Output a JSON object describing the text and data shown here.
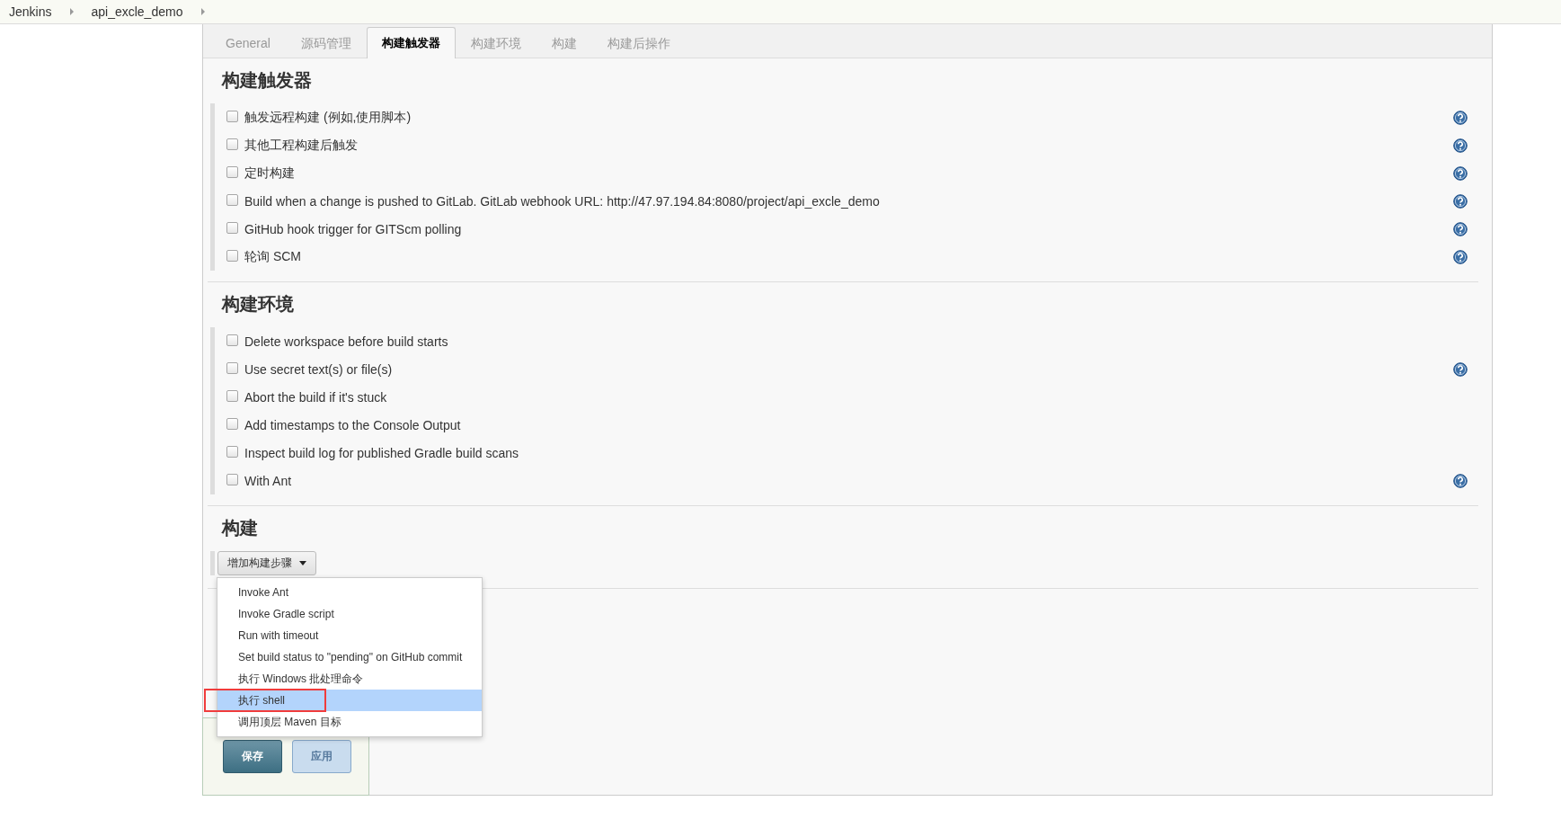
{
  "breadcrumbs": [
    {
      "label": "Jenkins"
    },
    {
      "label": "api_excle_demo"
    }
  ],
  "tabs": [
    {
      "label": "General",
      "selected": false
    },
    {
      "label": "源码管理",
      "selected": false
    },
    {
      "label": "构建触发器",
      "selected": true
    },
    {
      "label": "构建环境",
      "selected": false
    },
    {
      "label": "构建",
      "selected": false
    },
    {
      "label": "构建后操作",
      "selected": false
    }
  ],
  "sections": [
    {
      "title": "构建触发器",
      "options": [
        {
          "label": "触发远程构建 (例如,使用脚本)",
          "checked": false,
          "help": true
        },
        {
          "label": "其他工程构建后触发",
          "checked": false,
          "help": true
        },
        {
          "label": "定时构建",
          "checked": false,
          "help": true
        },
        {
          "label": "Build when a change is pushed to GitLab. GitLab webhook URL: http://47.97.194.84:8080/project/api_excle_demo",
          "checked": false,
          "help": true
        },
        {
          "label": "GitHub hook trigger for GITScm polling",
          "checked": false,
          "help": true
        },
        {
          "label": "轮询 SCM",
          "checked": false,
          "help": true
        }
      ]
    },
    {
      "title": "构建环境",
      "options": [
        {
          "label": "Delete workspace before build starts",
          "checked": false,
          "help": false
        },
        {
          "label": "Use secret text(s) or file(s)",
          "checked": false,
          "help": true
        },
        {
          "label": "Abort the build if it's stuck",
          "checked": false,
          "help": false
        },
        {
          "label": "Add timestamps to the Console Output",
          "checked": false,
          "help": false
        },
        {
          "label": "Inspect build log for published Gradle build scans",
          "checked": false,
          "help": false
        },
        {
          "label": "With Ant",
          "checked": false,
          "help": true
        }
      ]
    },
    {
      "title": "构建",
      "add_button": "增加构建步骤",
      "menu": [
        {
          "label": "Invoke Ant",
          "selected": false,
          "annotated": false
        },
        {
          "label": "Invoke Gradle script",
          "selected": false,
          "annotated": false
        },
        {
          "label": "Run with timeout",
          "selected": false,
          "annotated": false
        },
        {
          "label": "Set build status to \"pending\" on GitHub commit",
          "selected": false,
          "annotated": false
        },
        {
          "label": "执行 Windows 批处理命令",
          "selected": false,
          "annotated": false
        },
        {
          "label": "执行 shell",
          "selected": true,
          "annotated": true
        },
        {
          "label": "调用顶层 Maven 目标",
          "selected": false,
          "annotated": false
        }
      ]
    }
  ],
  "buttons": [
    {
      "label": "保存",
      "kind": "primary"
    },
    {
      "label": "应用",
      "kind": "secondary"
    }
  ]
}
